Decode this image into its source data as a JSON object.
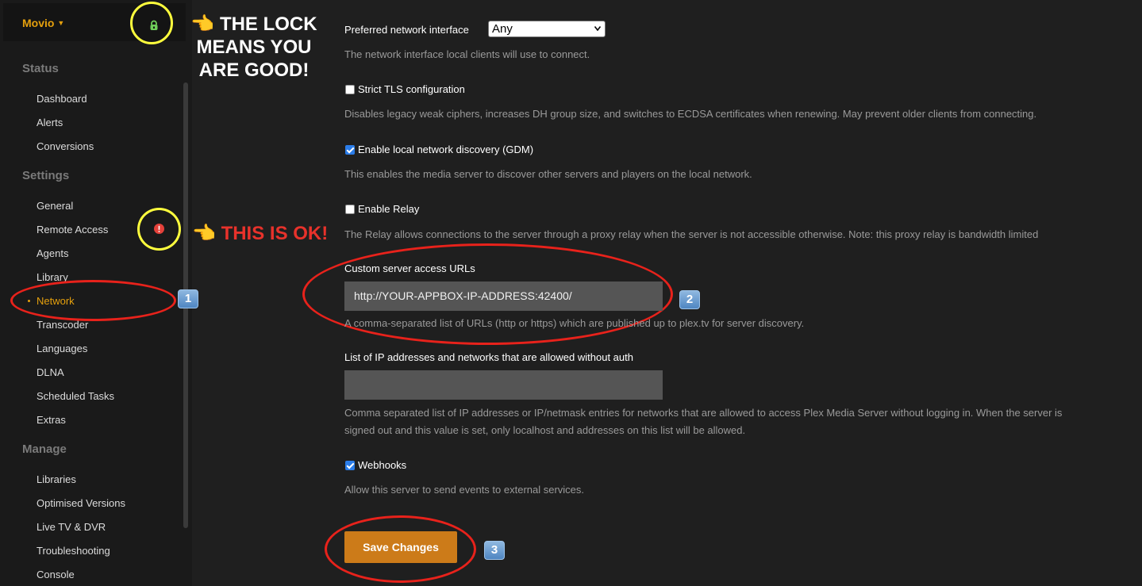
{
  "sidebar": {
    "server_name": "Movio",
    "sections": {
      "status": "Status",
      "settings": "Settings",
      "manage": "Manage"
    },
    "status_items": [
      "Dashboard",
      "Alerts",
      "Conversions"
    ],
    "settings_items": [
      "General",
      "Remote Access",
      "Agents",
      "Library",
      "Network",
      "Transcoder",
      "Languages",
      "DLNA",
      "Scheduled Tasks",
      "Extras"
    ],
    "manage_items": [
      "Libraries",
      "Optimised Versions",
      "Live TV & DVR",
      "Troubleshooting",
      "Console"
    ],
    "active_item": "Network"
  },
  "annotations": {
    "lock_note": "👈 THE LOCK\nMEANS YOU\nARE GOOD!",
    "lock_note_lines": [
      "THE LOCK",
      "MEANS YOU",
      "ARE GOOD!"
    ],
    "ok_note": "THIS IS OK!",
    "badges": [
      "1",
      "2",
      "3"
    ],
    "highlight_yellow": "#ffff3d",
    "highlight_red": "#e8221b"
  },
  "settings": {
    "preferred_interface": {
      "label": "Preferred network interface",
      "value": "Any",
      "desc": "The network interface local clients will use to connect."
    },
    "strict_tls": {
      "label": "Strict TLS configuration",
      "checked": false,
      "desc": "Disables legacy weak ciphers, increases DH group size, and switches to ECDSA certificates when renewing. May prevent older clients from connecting."
    },
    "gdm": {
      "label": "Enable local network discovery (GDM)",
      "checked": true,
      "desc": "This enables the media server to discover other servers and players on the local network."
    },
    "relay": {
      "label": "Enable Relay",
      "checked": false,
      "desc": "The Relay allows connections to the server through a proxy relay when the server is not accessible otherwise. Note: this proxy relay is bandwidth limited"
    },
    "custom_urls": {
      "label": "Custom server access URLs",
      "value": "http://YOUR-APPBOX-IP-ADDRESS:42400/",
      "desc": "A comma-separated list of URLs (http or https) which are published up to plex.tv for server discovery."
    },
    "allowed_networks": {
      "label": "List of IP addresses and networks that are allowed without auth",
      "value": "",
      "desc_line1": "Comma separated list of IP addresses or IP/netmask entries for networks that are allowed to access Plex Media Server without logging in. When the server is",
      "desc_line2": "signed out and this value is set, only localhost and addresses on this list will be allowed."
    },
    "webhooks": {
      "label": "Webhooks",
      "checked": true,
      "desc": "Allow this server to send events to external services."
    },
    "save_label": "Save Changes"
  },
  "colors": {
    "accent": "#e5a00d",
    "save_button": "#cc7b19",
    "lock_green": "#6fcf5a",
    "warn_red": "#e5413a"
  }
}
